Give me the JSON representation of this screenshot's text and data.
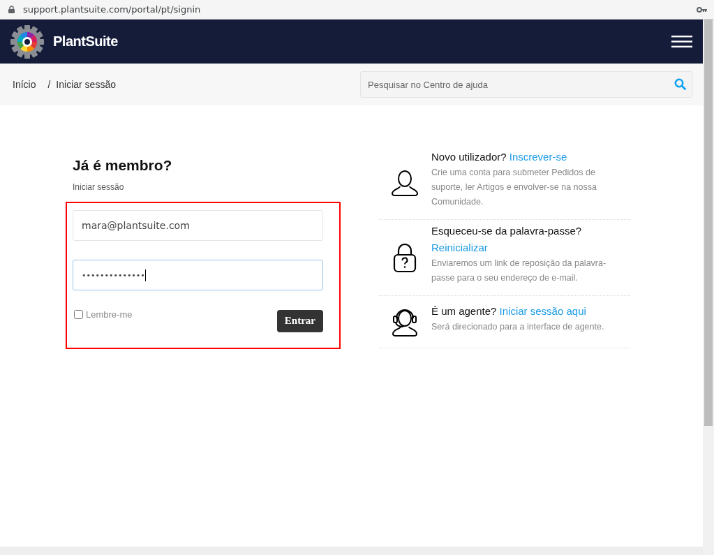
{
  "browser": {
    "url": "support.plantsuite.com/portal/pt/signin"
  },
  "header": {
    "brand": "PlantSuite"
  },
  "breadcrumbs": [
    {
      "label": "Início"
    },
    {
      "label": "Iniciar sessão"
    }
  ],
  "breadcrumb_separator": "/",
  "search": {
    "placeholder": "Pesquisar no Centro de ajuda"
  },
  "signin": {
    "title": "Já é membro?",
    "subtitle": "Iniciar sessão",
    "email": {
      "value": "mara@plantsuite.com",
      "focused": false
    },
    "password": {
      "value": "••••••••••••••",
      "focused": true
    },
    "remember": {
      "label": "Lembre-me",
      "checked": false
    },
    "submit": "Entrar"
  },
  "options": [
    {
      "kind": "user",
      "title": "Novo utilizador?",
      "link": "Inscrever-se",
      "description": "Crie uma conta para submeter Pedidos de suporte, ler Artigos e envolver-se na nossa Comunidade."
    },
    {
      "kind": "lock",
      "title": "Esqueceu-se da palavra-passe?",
      "link": "Reinicializar",
      "description": "Enviaremos um link de reposição da palavra-passe para o seu endereço de e-mail."
    },
    {
      "kind": "agent",
      "title": "É um agente?",
      "link": "Iniciar sessão aqui",
      "description": "Será direcionado para a interface de agente."
    }
  ]
}
